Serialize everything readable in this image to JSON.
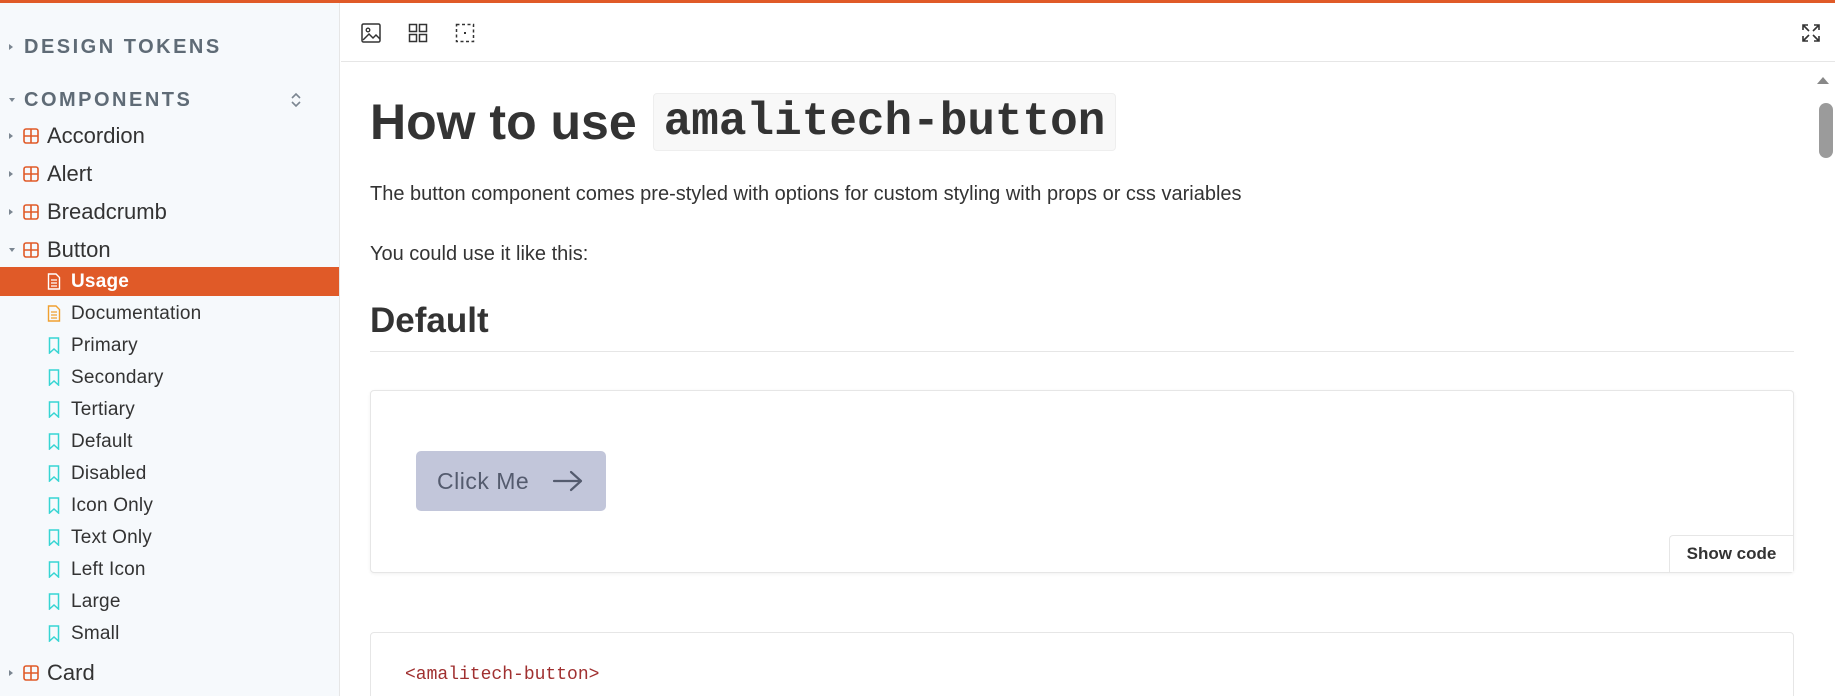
{
  "colors": {
    "accent": "#e05a28",
    "component_icon": "#e05a28",
    "doc_icon": "#f0a030",
    "story_icon": "#37d5d3",
    "demo_button_bg": "#c2c6da"
  },
  "sidebar": {
    "design_tokens_label": "DESIGN TOKENS",
    "components_label": "COMPONENTS",
    "components": [
      {
        "label": "Accordion",
        "expanded": false
      },
      {
        "label": "Alert",
        "expanded": false
      },
      {
        "label": "Breadcrumb",
        "expanded": false
      },
      {
        "label": "Button",
        "expanded": true
      }
    ],
    "button_children": [
      {
        "label": "Usage",
        "icon": "document-icon",
        "active": true
      },
      {
        "label": "Documentation",
        "icon": "document-icon",
        "active": false
      },
      {
        "label": "Primary",
        "icon": "bookmark-icon"
      },
      {
        "label": "Secondary",
        "icon": "bookmark-icon"
      },
      {
        "label": "Tertiary",
        "icon": "bookmark-icon"
      },
      {
        "label": "Default",
        "icon": "bookmark-icon"
      },
      {
        "label": "Disabled",
        "icon": "bookmark-icon"
      },
      {
        "label": "Icon Only",
        "icon": "bookmark-icon"
      },
      {
        "label": "Text Only",
        "icon": "bookmark-icon"
      },
      {
        "label": "Left Icon",
        "icon": "bookmark-icon"
      },
      {
        "label": "Large",
        "icon": "bookmark-icon"
      },
      {
        "label": "Small",
        "icon": "bookmark-icon"
      }
    ],
    "after_components": [
      {
        "label": "Card",
        "expanded": false
      }
    ]
  },
  "toolbar": {
    "tools": [
      "image-icon",
      "grid-icon",
      "outline-icon"
    ],
    "fullscreen_icon": "fullscreen-icon"
  },
  "doc": {
    "title_prefix": "How to use",
    "title_code": "amalitech-button",
    "intro": "The button component comes pre-styled with options for custom styling with props or css variables",
    "usage_line": "You could use it like this:",
    "section_heading": "Default",
    "demo_button_label": "Click Me",
    "show_code_label": "Show code",
    "code_line": "<amalitech-button>"
  }
}
